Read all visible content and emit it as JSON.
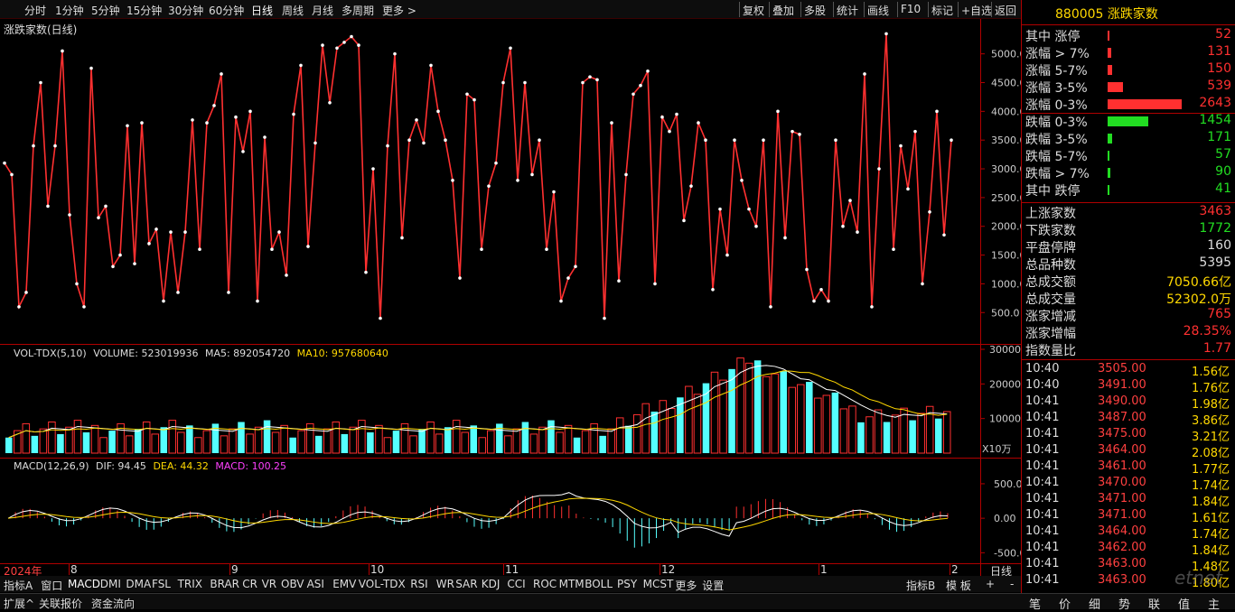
{
  "topbar": {
    "periods": [
      "分时",
      "1分钟",
      "5分钟",
      "15分钟",
      "30分钟",
      "60分钟",
      "日线",
      "周线",
      "月线",
      "多周期",
      "更多 >"
    ],
    "selected": "日线",
    "tools": [
      "复权",
      "叠加",
      "多股",
      "统计",
      "画线",
      "F10",
      "标记",
      "+自选",
      "返回"
    ]
  },
  "main": {
    "title": "涨跌家数(日线)",
    "y_ticks": [
      "5000.0",
      "4500.0",
      "4000.0",
      "3500.0",
      "3000.0",
      "2500.0",
      "2000.0",
      "1500.0",
      "1000.0",
      "500.0"
    ]
  },
  "vol": {
    "label": "VOL-TDX(5,10)",
    "volume_label": "VOLUME: 523019936",
    "ma5_label": "MA5: 892054720",
    "ma10_label": "MA10: 957680640",
    "y_ticks": [
      "30000",
      "20000",
      "10000"
    ],
    "unit": "X10万"
  },
  "macd": {
    "label": "MACD(12,26,9)",
    "dif_label": "DIF: 94.45",
    "dea_label": "DEA: 44.32",
    "macd_label": "MACD: 100.25",
    "y_ticks": [
      "500.0",
      "0.00",
      "-500.0"
    ]
  },
  "dates": {
    "year": "2024年",
    "months": [
      "8",
      "9",
      "10",
      "11",
      "12",
      "1",
      "2"
    ]
  },
  "right_panel": {
    "code": "880005",
    "name": "涨跌家数",
    "breadth": [
      {
        "label": "其中 涨停",
        "value": "52",
        "color": "#ff3030",
        "frac": 0.0197
      },
      {
        "label": "涨幅 > 7%",
        "value": "131",
        "color": "#ff3030",
        "frac": 0.0496
      },
      {
        "label": "涨幅 5-7%",
        "value": "150",
        "color": "#ff3030",
        "frac": 0.0568
      },
      {
        "label": "涨幅 3-5%",
        "value": "539",
        "color": "#ff3030",
        "frac": 0.2039
      },
      {
        "label": "涨幅 0-3%",
        "value": "2643",
        "color": "#ff3030",
        "frac": 1.0
      },
      {
        "label": "跌幅 0-3%",
        "value": "1454",
        "color": "#22dd22",
        "frac": 0.5501
      },
      {
        "label": "跌幅 3-5%",
        "value": "171",
        "color": "#22dd22",
        "frac": 0.0647
      },
      {
        "label": "跌幅 5-7%",
        "value": "57",
        "color": "#22dd22",
        "frac": 0.0216
      },
      {
        "label": "跌幅 > 7%",
        "value": "90",
        "color": "#22dd22",
        "frac": 0.0341
      },
      {
        "label": "其中 跌停",
        "value": "41",
        "color": "#22dd22",
        "frac": 0.0155
      }
    ],
    "stats": [
      {
        "label": "上涨家数",
        "value": "3463",
        "color": "#ff3030"
      },
      {
        "label": "下跌家数",
        "value": "1772",
        "color": "#22dd22"
      },
      {
        "label": "平盘停牌",
        "value": "160",
        "color": "#dddddd"
      },
      {
        "label": "总品种数",
        "value": "5395",
        "color": "#dddddd"
      },
      {
        "label": "总成交额",
        "value": "7050.66亿",
        "color": "#ffd800"
      },
      {
        "label": "总成交量",
        "value": "52302.0万",
        "color": "#ffd800"
      },
      {
        "label": "涨家增减",
        "value": "765",
        "color": "#ff3030"
      },
      {
        "label": "涨家增幅",
        "value": "28.35%",
        "color": "#ff3030"
      },
      {
        "label": "指数量比",
        "value": "1.77",
        "color": "#ff3030"
      }
    ],
    "ticks": [
      {
        "time": "10:40",
        "price": "3505.00",
        "vol": "1.56亿"
      },
      {
        "time": "10:40",
        "price": "3491.00",
        "vol": "1.76亿"
      },
      {
        "time": "10:41",
        "price": "3490.00",
        "vol": "1.98亿"
      },
      {
        "time": "10:41",
        "price": "3487.00",
        "vol": "3.86亿"
      },
      {
        "time": "10:41",
        "price": "3475.00",
        "vol": "3.21亿"
      },
      {
        "time": "10:41",
        "price": "3464.00",
        "vol": "2.08亿"
      },
      {
        "time": "10:41",
        "price": "3461.00",
        "vol": "1.77亿"
      },
      {
        "time": "10:41",
        "price": "3470.00",
        "vol": "1.74亿"
      },
      {
        "time": "10:41",
        "price": "3471.00",
        "vol": "1.84亿"
      },
      {
        "time": "10:41",
        "price": "3471.00",
        "vol": "1.61亿"
      },
      {
        "time": "10:41",
        "price": "3464.00",
        "vol": "1.74亿"
      },
      {
        "time": "10:41",
        "price": "3462.00",
        "vol": "1.84亿"
      },
      {
        "time": "10:41",
        "price": "3463.00",
        "vol": "1.48亿"
      },
      {
        "time": "10:41",
        "price": "3463.00",
        "vol": "1.80亿"
      }
    ],
    "tabs": [
      "笔",
      "价",
      "细",
      "势",
      "联",
      "值",
      "主"
    ]
  },
  "indicators": {
    "left": [
      "指标A",
      "窗口",
      "MACD",
      "DMI",
      "DMA",
      "FSL",
      "TRIX",
      "BRAR",
      "CR",
      "VR",
      "OBV",
      "ASI",
      "EMV",
      "VOL-TDX",
      "RSI",
      "WR",
      "SAR",
      "KDJ",
      "CCI",
      "ROC",
      "MTM",
      "BOLL",
      "PSY",
      "MCST",
      "更多",
      "设置"
    ],
    "selected": "MACD",
    "right": [
      "指标B",
      "模 板",
      "+",
      "-"
    ],
    "date_axis_btn": "日线"
  },
  "statusbar": {
    "items": [
      "扩展^",
      "关联报价",
      "资金流向"
    ]
  },
  "colors": {
    "up": "#ff3030",
    "down": "#55ffff",
    "frame": "#b00000",
    "accent": "#ffd800"
  },
  "chart_data": [
    {
      "type": "line",
      "title": "涨跌家数(日线)",
      "ylim": [
        300,
        5450
      ],
      "series": [
        {
          "name": "涨跌家数",
          "values": [
            3100,
            2900,
            600,
            850,
            3400,
            4500,
            2350,
            3400,
            5050,
            2200,
            1000,
            600,
            4750,
            2150,
            2350,
            1300,
            1500,
            3750,
            1350,
            3800,
            1700,
            1950,
            700,
            1900,
            850,
            1900,
            3850,
            1600,
            3800,
            4100,
            4650,
            850,
            3900,
            3300,
            4000,
            700,
            3550,
            1600,
            1900,
            1150,
            3950,
            4800,
            1650,
            3450,
            5150,
            4150,
            5100,
            5200,
            5300,
            5150,
            1200,
            3000,
            400,
            3400,
            5000,
            1800,
            3500,
            3850,
            3450,
            4800,
            4000,
            3500,
            2800,
            1100,
            4300,
            4200,
            1600,
            2700,
            3100,
            4500,
            5100,
            2800,
            4500,
            2900,
            3500,
            1600,
            2600,
            700,
            1100,
            1300,
            4500,
            4600,
            4550,
            400,
            3800,
            1050,
            2900,
            4300,
            4450,
            4700,
            1000,
            3900,
            3650,
            3950,
            2100,
            2700,
            3800,
            3500,
            900,
            2300,
            1500,
            3500,
            2800,
            2300,
            2000,
            3500,
            600,
            4000,
            1800,
            3650,
            3600,
            1250,
            700,
            900,
            700,
            3500,
            2000,
            2450,
            1900,
            4650,
            600,
            3000,
            5350,
            1600,
            3400,
            2650,
            3650,
            1000,
            2250,
            4000,
            1850,
            3500
          ]
        }
      ]
    }
  ]
}
